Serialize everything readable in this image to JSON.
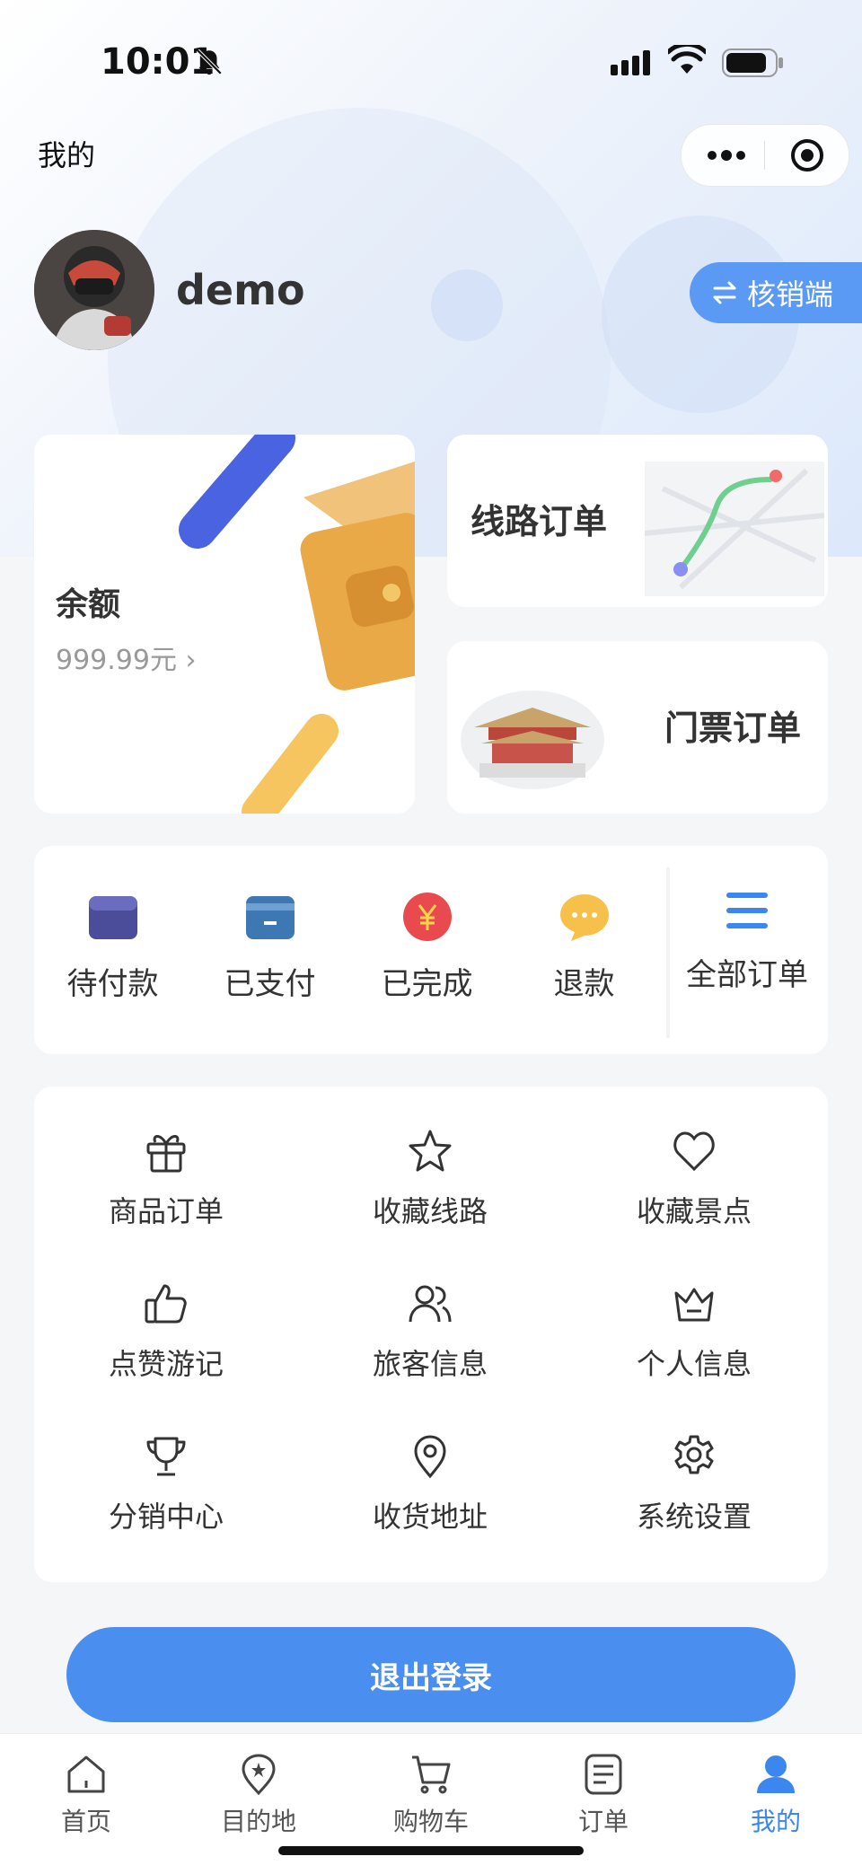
{
  "status_bar": {
    "time": "10:01"
  },
  "header": {
    "title": "我的"
  },
  "profile": {
    "username": "demo",
    "switch_label": "核销端"
  },
  "balance": {
    "label": "余额",
    "value": "999.99元 ›"
  },
  "order_cards": {
    "route": "线路订单",
    "ticket": "门票订单"
  },
  "order_status": {
    "items": [
      "待付款",
      "已支付",
      "已完成",
      "退款"
    ],
    "all_label": "全部订单"
  },
  "menu": {
    "items": [
      {
        "label": "商品订单",
        "icon": "gift-icon"
      },
      {
        "label": "收藏线路",
        "icon": "star-icon"
      },
      {
        "label": "收藏景点",
        "icon": "heart-icon"
      },
      {
        "label": "点赞游记",
        "icon": "thumbs-up-icon"
      },
      {
        "label": "旅客信息",
        "icon": "users-icon"
      },
      {
        "label": "个人信息",
        "icon": "crown-icon"
      },
      {
        "label": "分销中心",
        "icon": "trophy-icon"
      },
      {
        "label": "收货地址",
        "icon": "map-pin-icon"
      },
      {
        "label": "系统设置",
        "icon": "gear-icon"
      }
    ]
  },
  "logout_label": "退出登录",
  "tabbar": {
    "items": [
      {
        "label": "首页",
        "icon": "home-icon"
      },
      {
        "label": "目的地",
        "icon": "destination-icon"
      },
      {
        "label": "购物车",
        "icon": "cart-icon"
      },
      {
        "label": "订单",
        "icon": "order-icon"
      },
      {
        "label": "我的",
        "icon": "user-icon"
      }
    ],
    "active_color": "#3b86ef"
  },
  "colors": {
    "accent": "#4a8ef0",
    "background": "#f5f6f8"
  }
}
